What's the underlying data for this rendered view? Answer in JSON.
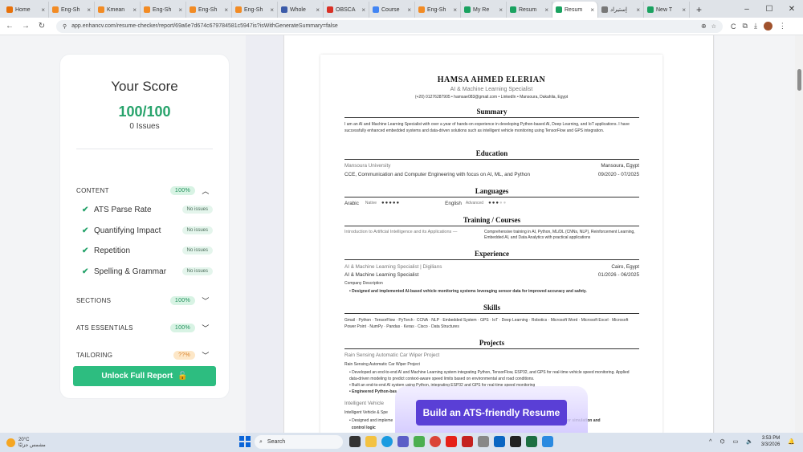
{
  "browser": {
    "tabs": [
      {
        "label": "Home",
        "color": "#e8710a"
      },
      {
        "label": "Eng-Sh",
        "color": "#f28b24"
      },
      {
        "label": "Kmean",
        "color": "#f28b24"
      },
      {
        "label": "Eng-Sh",
        "color": "#f28b24"
      },
      {
        "label": "Eng-Sh",
        "color": "#f28b24"
      },
      {
        "label": "Eng-Sh",
        "color": "#f28b24"
      },
      {
        "label": "Whole",
        "color": "#3b5ba9"
      },
      {
        "label": "OBSCA",
        "color": "#d93025"
      },
      {
        "label": "Course",
        "color": "#4285f4"
      },
      {
        "label": "Eng-Sh",
        "color": "#f28b24"
      },
      {
        "label": "My Re",
        "color": "#1aa260"
      },
      {
        "label": "Resum",
        "color": "#1aa260"
      },
      {
        "label": "Resum",
        "color": "#1aa260",
        "active": true
      },
      {
        "label": "إستيراد",
        "color": "#777777"
      },
      {
        "label": "New T",
        "color": "#1aa260"
      }
    ],
    "url": "app.enhancv.com/resume-checker/report/69a6e7d674c679784581c5947is?isWithGenerateSummary=false"
  },
  "score": {
    "title": "Your Score",
    "value": "100/100",
    "issues": "0 Issues"
  },
  "sections": {
    "content": {
      "label": "CONTENT",
      "pct": "100%"
    },
    "content_items": [
      {
        "label": "ATS Parse Rate",
        "status": "No issues"
      },
      {
        "label": "Quantifying Impact",
        "status": "No issues"
      },
      {
        "label": "Repetition",
        "status": "No issues"
      },
      {
        "label": "Spelling & Grammar",
        "status": "No issues"
      }
    ],
    "sections": {
      "label": "SECTIONS",
      "pct": "100%"
    },
    "ats": {
      "label": "ATS ESSENTIALS",
      "pct": "100%"
    },
    "tailoring": {
      "label": "TAILORING",
      "pct": "??%"
    }
  },
  "unlock_label": "Unlock Full Report",
  "resume": {
    "name": "HAMSA AHMED ELERIAN",
    "role": "AI & Machine Learning Specialist",
    "contact": "(+20) 01276287905  •  hamsae083@gmail.com  •  LinkedIn  •  Mansoura, Dakahlia, Egypt",
    "summary_h": "Summary",
    "summary": "I am an AI and Machine Learning Specialist with over a year of hands-on experience in developing Python-based AI, Deep Learning, and IoT applications. I have successfully enhanced embedded systems and data-driven solutions such as intelligent vehicle monitoring using TensorFlow and GPS integration.",
    "education_h": "Education",
    "edu_school": "Mansoura University",
    "edu_loc": "Mansoura, Egypt",
    "edu_degree": "CCE, Communication and Computer Engineering with focus on AI, ML, and Python",
    "edu_dates": "09/2020 - 07/2025",
    "languages_h": "Languages",
    "lang1": "Arabic",
    "lang1_lvl": "Native",
    "lang2": "English",
    "lang2_lvl": "Advanced",
    "training_h": "Training / Courses",
    "training_title": "Introduction to Artificial Intelligence and its Applications —",
    "training_desc": "Comprehensive training in AI, Python, ML/DL (CNNs, NLP), Reinforcement Learning, Embedded AI, and Data Analytics with practical applications",
    "experience_h": "Experience",
    "exp_title": "AI & Machine Learning Specialist | Digilians",
    "exp_loc": "Cairo, Egypt",
    "exp_role": "AI & Machine Learning Specialist",
    "exp_dates": "01/2026 - 06/2025",
    "exp_company": "Company Description",
    "exp_bullet": "Designed and implemented AI-based vehicle monitoring systems leveraging sensor data for improved accuracy and safety.",
    "skills_h": "Skills",
    "skills": "Gmail · Python · TensorFlow · PyTorch · CCNA · NLP · Embedded System · GPS · IoT · Deep Learning · Robotics · Microsoft Word · Microsoft Excel · Microsoft Power Point · NumPy · Pandas · Keras · Cisco · Data Structures",
    "projects_h": "Projects",
    "proj1_title": "Rain Sensing Automatic Car Wiper Project",
    "proj1_sub": "Rain Sensing Automatic Car Wiper Project",
    "proj1_b1": "Developed an end-to-end AI and Machine Learning system integrating Python, TensorFlow, ESP32, and GPS for real-time vehicle speed monitoring. Applied data-driven modeling to predict context-aware speed limits based on environmental and road conditions.",
    "proj1_b2": "Built an end-to-end AI system using Python, integrating ESP32 and GPS for real-time speed monitoring",
    "proj1_b3": "Engineered Python-bas",
    "proj2_title": "Intelligent Vehicle",
    "proj2_sub": "Intelligent Vehicle & Spe",
    "proj2_b1": "Designed and impleme",
    "proj2_b1_end": "ython for simulation and",
    "proj2_b2": "control logic"
  },
  "cta_label": "Build an ATS-friendly Resume",
  "taskbar": {
    "temp": "20°C",
    "weather": "مشمس جزئيًا",
    "search": "Search",
    "time": "3:53 PM",
    "date": "3/3/2026"
  }
}
